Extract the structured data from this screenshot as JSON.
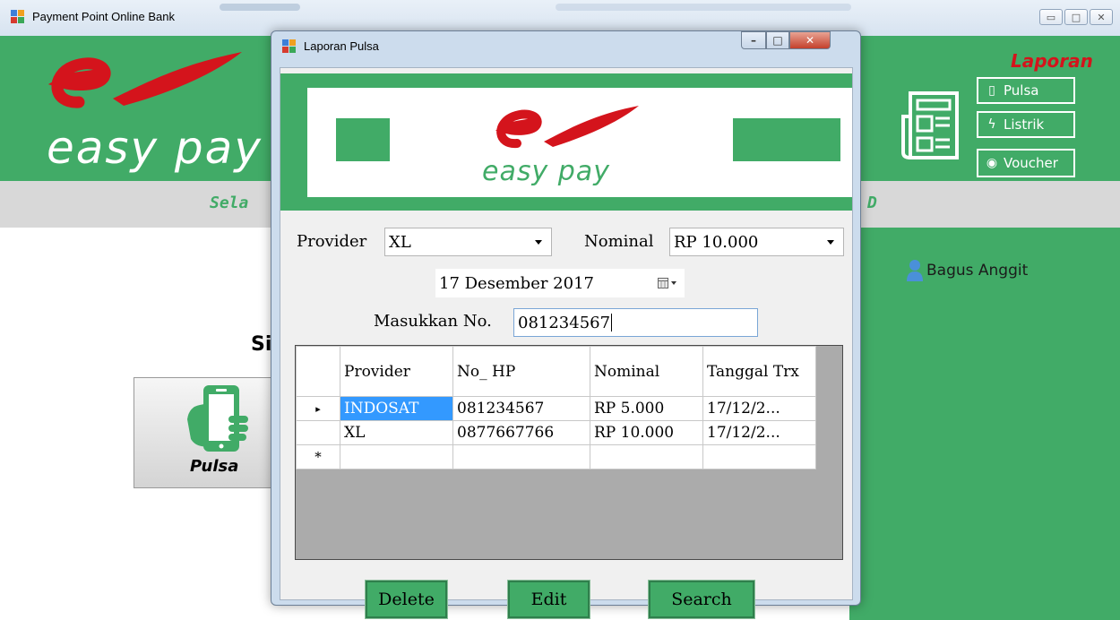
{
  "main_window": {
    "title": "Payment Point Online Bank",
    "logo_word": "easy pay",
    "banner_left_fragment": "Sela",
    "banner_right_fragment": "D",
    "laporan": {
      "title": "Laporan",
      "buttons": [
        {
          "label": "Pulsa",
          "icon": "phone-icon"
        },
        {
          "label": "Listrik",
          "icon": "bolt-icon"
        },
        {
          "label": "Voucher",
          "icon": "gamepad-icon"
        }
      ]
    },
    "user_name": "Bagus Anggit",
    "left_fragment": "Sil",
    "pulsa_tile_label": "Pulsa",
    "colors": {
      "brand_green": "#41ab67",
      "logo_red": "#d4141c"
    }
  },
  "dialog": {
    "title": "Laporan Pulsa",
    "logo_word": "easy pay",
    "provider_label": "Provider",
    "provider_value": "XL",
    "nominal_label": "Nominal",
    "nominal_value": "RP 10.000",
    "date_value": "17 Desember 2017",
    "number_label": "Masukkan No.",
    "number_value": "081234567",
    "grid": {
      "columns": [
        "Provider",
        "No_ HP",
        "Nominal",
        "Tanggal Trx"
      ],
      "rows": [
        {
          "provider": "INDOSAT",
          "no_hp": "081234567",
          "nominal": "RP 5.000",
          "tanggal": "17/12/2..."
        },
        {
          "provider": "XL",
          "no_hp": "0877667766",
          "nominal": "RP 10.000",
          "tanggal": "17/12/2..."
        }
      ],
      "row_marker_current": "▸",
      "row_marker_new": "*"
    },
    "buttons": {
      "delete": "Delete",
      "edit": "Edit",
      "search": "Search"
    }
  }
}
